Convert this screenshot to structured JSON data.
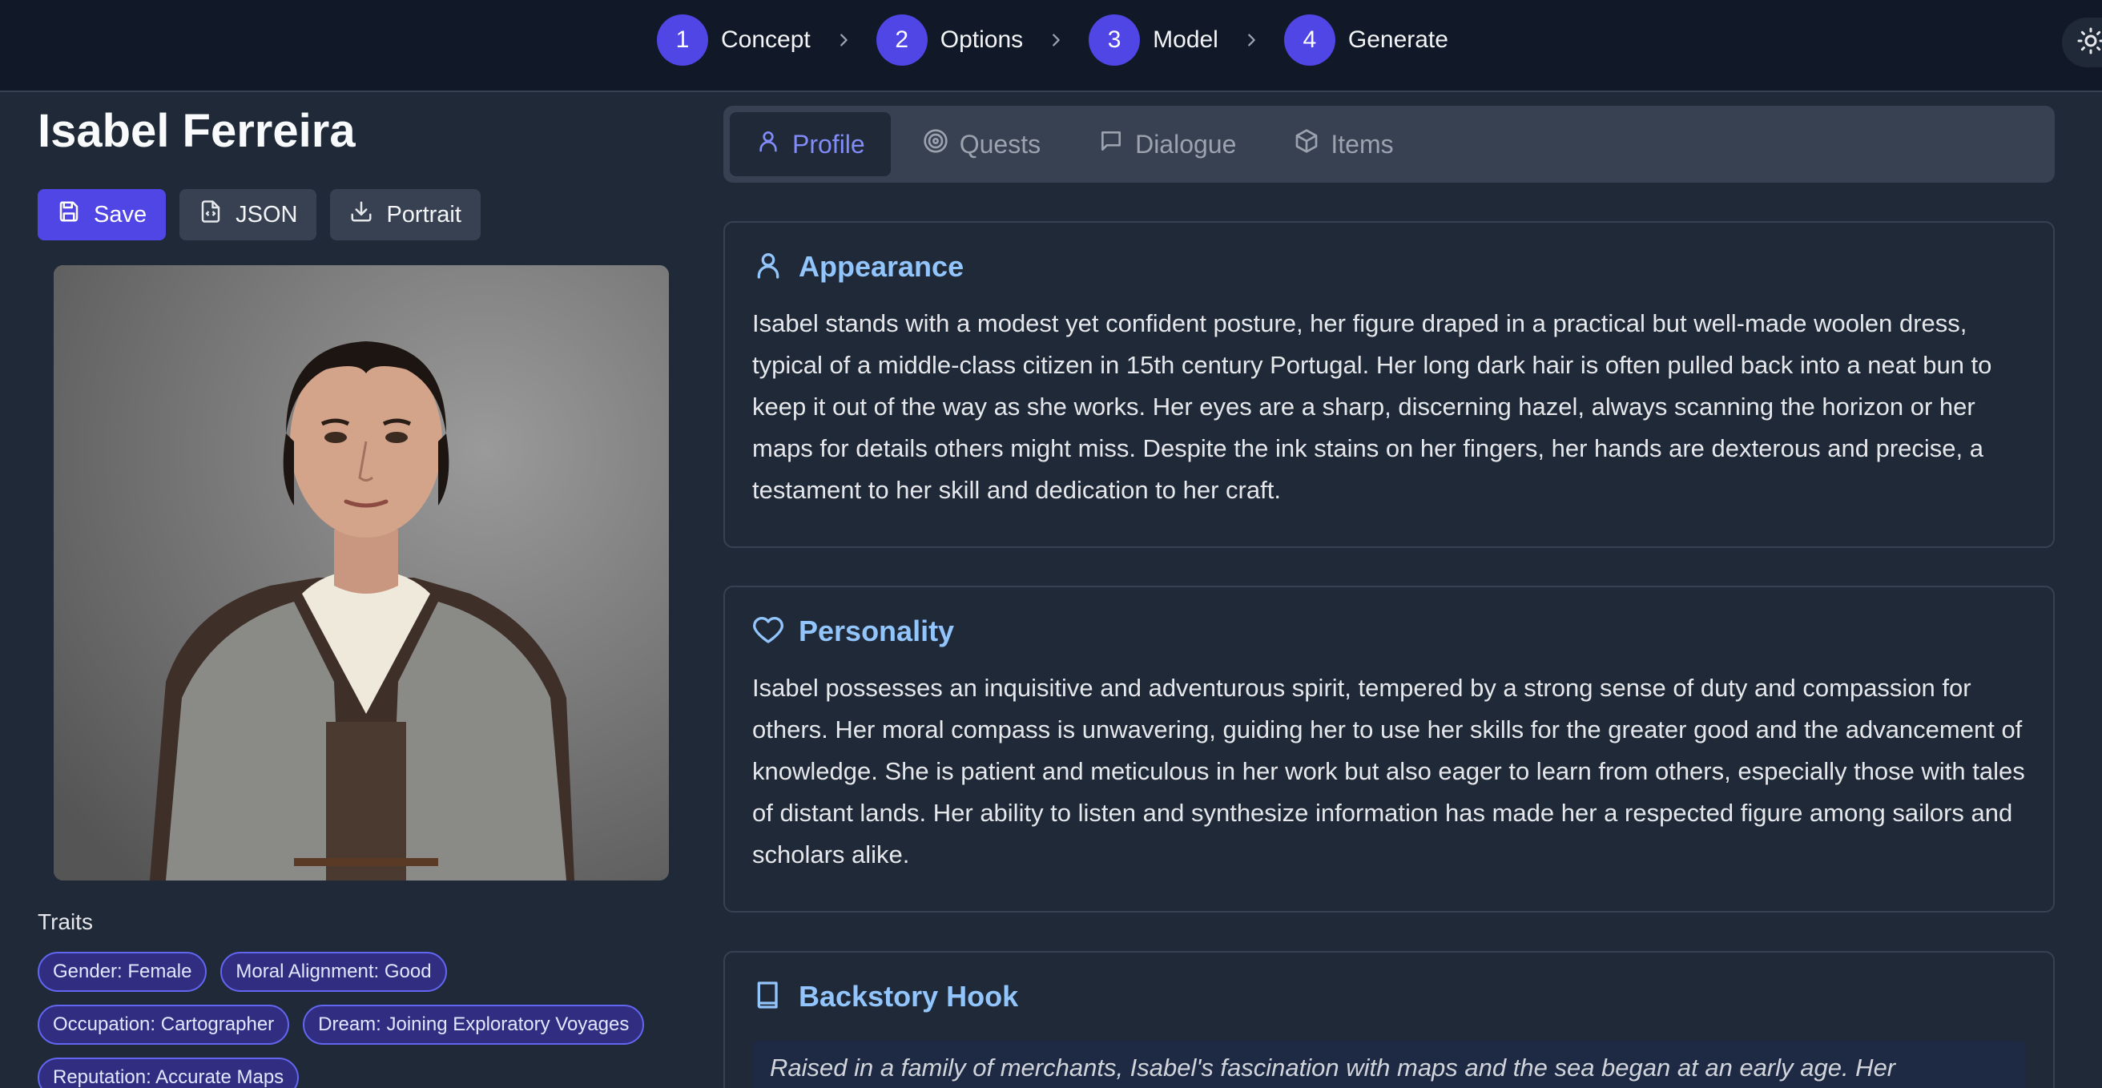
{
  "stepper": {
    "steps": [
      {
        "num": "1",
        "label": "Concept"
      },
      {
        "num": "2",
        "label": "Options"
      },
      {
        "num": "3",
        "label": "Model"
      },
      {
        "num": "4",
        "label": "Generate"
      }
    ]
  },
  "character": {
    "name": "Isabel Ferreira",
    "actions": {
      "save": "Save",
      "json": "JSON",
      "portrait": "Portrait"
    },
    "traits_label": "Traits",
    "traits": [
      "Gender: Female",
      "Moral Alignment: Good",
      "Occupation: Cartographer",
      "Dream: Joining Exploratory Voyages",
      "Reputation: Accurate Maps"
    ]
  },
  "tabs": [
    {
      "label": "Profile",
      "icon": "user-icon",
      "active": true
    },
    {
      "label": "Quests",
      "icon": "target-icon",
      "active": false
    },
    {
      "label": "Dialogue",
      "icon": "chat-icon",
      "active": false
    },
    {
      "label": "Items",
      "icon": "box-icon",
      "active": false
    }
  ],
  "sections": {
    "appearance": {
      "title": "Appearance",
      "text": "Isabel stands with a modest yet confident posture, her figure draped in a practical but well-made woolen dress, typical of a middle-class citizen in 15th century Portugal. Her long dark hair is often pulled back into a neat bun to keep it out of the way as she works. Her eyes are a sharp, discerning hazel, always scanning the horizon or her maps for details others might miss. Despite the ink stains on her fingers, her hands are dexterous and precise, a testament to her skill and dedication to her craft."
    },
    "personality": {
      "title": "Personality",
      "text": "Isabel possesses an inquisitive and adventurous spirit, tempered by a strong sense of duty and compassion for others. Her moral compass is unwavering, guiding her to use her skills for the greater good and the advancement of knowledge. She is patient and meticulous in her work but also eager to learn from others, especially those with tales of distant lands. Her ability to listen and synthesize information has made her a respected figure among sailors and scholars alike."
    },
    "backstory": {
      "title": "Backstory Hook",
      "text": "Raised in a family of merchants, Isabel's fascination with maps and the sea began at an early age. Her"
    }
  },
  "colors": {
    "accent": "#4f46e5",
    "heading": "#93c5fd",
    "tab_active": "#818cf8"
  }
}
